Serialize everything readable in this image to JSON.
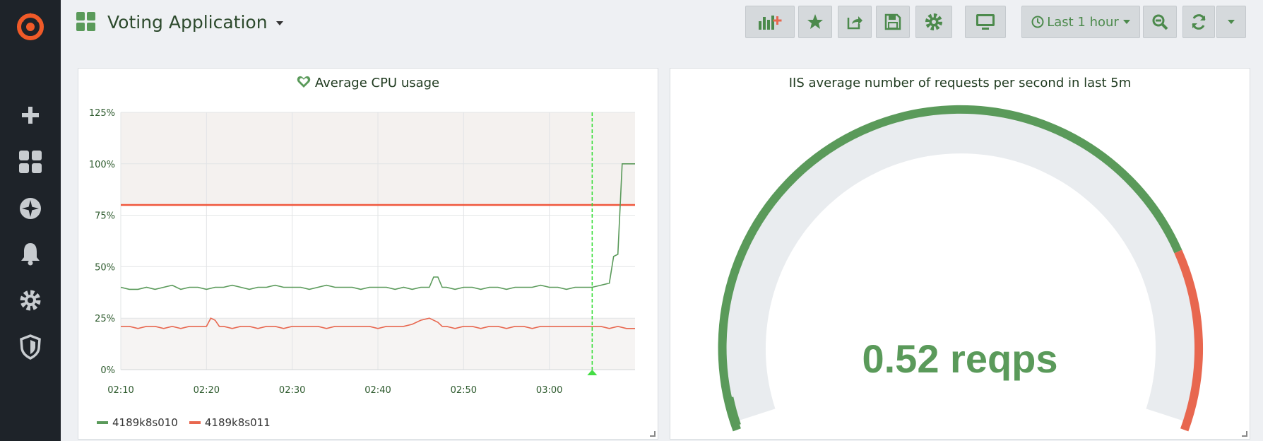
{
  "header": {
    "title": "Voting Application",
    "time_range": "Last 1 hour"
  },
  "sidebar": {
    "items": [
      "grafana-logo",
      "create",
      "dashboards",
      "explore",
      "alerting",
      "configuration",
      "server-admin"
    ]
  },
  "colors": {
    "green": "#5a9a5a",
    "red": "#e8674f",
    "threshold": "#f0573c",
    "gauge_track": "#e9ecef"
  },
  "panels": {
    "cpu": {
      "title": "Average CPU usage",
      "legend": [
        {
          "name": "4189k8s010",
          "color": "#5a9a5a"
        },
        {
          "name": "4189k8s011",
          "color": "#e8674f"
        }
      ]
    },
    "gauge": {
      "title": "IIS average number of requests per second in last 5m",
      "value_text": "0.52 reqps"
    }
  },
  "chart_data": {
    "type": "line",
    "title": "Average CPU usage",
    "y_ticks": [
      "0%",
      "25%",
      "50%",
      "75%",
      "100%",
      "125%"
    ],
    "ylim": [
      0,
      125
    ],
    "x_ticks": [
      "02:10",
      "02:20",
      "02:30",
      "02:40",
      "02:50",
      "03:00"
    ],
    "x_tick_minutes": [
      10,
      20,
      30,
      40,
      50,
      60
    ],
    "xlim_minutes": [
      10,
      70
    ],
    "threshold": 80,
    "marker_minute": 65,
    "grid": true,
    "series": [
      {
        "name": "4189k8s010",
        "color": "#5a9a5a",
        "points": [
          [
            10,
            40
          ],
          [
            11,
            39
          ],
          [
            12,
            39
          ],
          [
            13,
            40
          ],
          [
            14,
            39
          ],
          [
            15,
            40
          ],
          [
            16,
            41
          ],
          [
            17,
            39
          ],
          [
            18,
            40
          ],
          [
            19,
            40
          ],
          [
            20,
            39
          ],
          [
            21,
            40
          ],
          [
            22,
            40
          ],
          [
            23,
            41
          ],
          [
            24,
            40
          ],
          [
            25,
            39
          ],
          [
            26,
            40
          ],
          [
            27,
            40
          ],
          [
            28,
            41
          ],
          [
            29,
            40
          ],
          [
            30,
            40
          ],
          [
            31,
            40
          ],
          [
            32,
            39
          ],
          [
            33,
            40
          ],
          [
            34,
            41
          ],
          [
            35,
            40
          ],
          [
            36,
            40
          ],
          [
            37,
            40
          ],
          [
            38,
            39
          ],
          [
            39,
            40
          ],
          [
            40,
            40
          ],
          [
            41,
            40
          ],
          [
            42,
            39
          ],
          [
            43,
            40
          ],
          [
            44,
            39
          ],
          [
            45,
            40
          ],
          [
            46,
            40
          ],
          [
            46.5,
            45
          ],
          [
            47,
            45
          ],
          [
            47.5,
            40
          ],
          [
            48,
            40
          ],
          [
            49,
            39
          ],
          [
            50,
            40
          ],
          [
            51,
            40
          ],
          [
            52,
            39
          ],
          [
            53,
            40
          ],
          [
            54,
            40
          ],
          [
            55,
            39
          ],
          [
            56,
            40
          ],
          [
            57,
            40
          ],
          [
            58,
            40
          ],
          [
            59,
            41
          ],
          [
            60,
            40
          ],
          [
            61,
            40
          ],
          [
            62,
            39
          ],
          [
            63,
            40
          ],
          [
            64,
            40
          ],
          [
            65,
            40
          ],
          [
            66,
            41
          ],
          [
            67,
            42
          ],
          [
            67.5,
            55
          ],
          [
            68,
            56
          ],
          [
            68.5,
            100
          ],
          [
            69,
            100
          ],
          [
            70,
            100
          ]
        ]
      },
      {
        "name": "4189k8s011",
        "color": "#e8674f",
        "points": [
          [
            10,
            21
          ],
          [
            11,
            21
          ],
          [
            12,
            20
          ],
          [
            13,
            21
          ],
          [
            14,
            21
          ],
          [
            15,
            20
          ],
          [
            16,
            21
          ],
          [
            17,
            20
          ],
          [
            18,
            21
          ],
          [
            19,
            21
          ],
          [
            20,
            21
          ],
          [
            20.5,
            25
          ],
          [
            21,
            24
          ],
          [
            21.5,
            21
          ],
          [
            22,
            21
          ],
          [
            23,
            20
          ],
          [
            24,
            21
          ],
          [
            25,
            21
          ],
          [
            26,
            20
          ],
          [
            27,
            21
          ],
          [
            28,
            21
          ],
          [
            29,
            20
          ],
          [
            30,
            21
          ],
          [
            31,
            21
          ],
          [
            32,
            21
          ],
          [
            33,
            21
          ],
          [
            34,
            20
          ],
          [
            35,
            21
          ],
          [
            36,
            21
          ],
          [
            37,
            21
          ],
          [
            38,
            21
          ],
          [
            39,
            21
          ],
          [
            40,
            20
          ],
          [
            41,
            21
          ],
          [
            42,
            21
          ],
          [
            43,
            21
          ],
          [
            44,
            22
          ],
          [
            45,
            24
          ],
          [
            46,
            25
          ],
          [
            47,
            23
          ],
          [
            47.5,
            21
          ],
          [
            48,
            21
          ],
          [
            49,
            20
          ],
          [
            50,
            21
          ],
          [
            51,
            21
          ],
          [
            52,
            20
          ],
          [
            53,
            21
          ],
          [
            54,
            21
          ],
          [
            55,
            20
          ],
          [
            56,
            21
          ],
          [
            57,
            21
          ],
          [
            58,
            20
          ],
          [
            59,
            21
          ],
          [
            60,
            21
          ],
          [
            61,
            21
          ],
          [
            62,
            21
          ],
          [
            63,
            21
          ],
          [
            64,
            21
          ],
          [
            65,
            21
          ],
          [
            66,
            21
          ],
          [
            67,
            20
          ],
          [
            68,
            21
          ],
          [
            69,
            20
          ],
          [
            70,
            20
          ]
        ]
      }
    ]
  },
  "gauge_data": {
    "value": 0.52,
    "unit": "reqps",
    "green_fraction": 0.8
  }
}
